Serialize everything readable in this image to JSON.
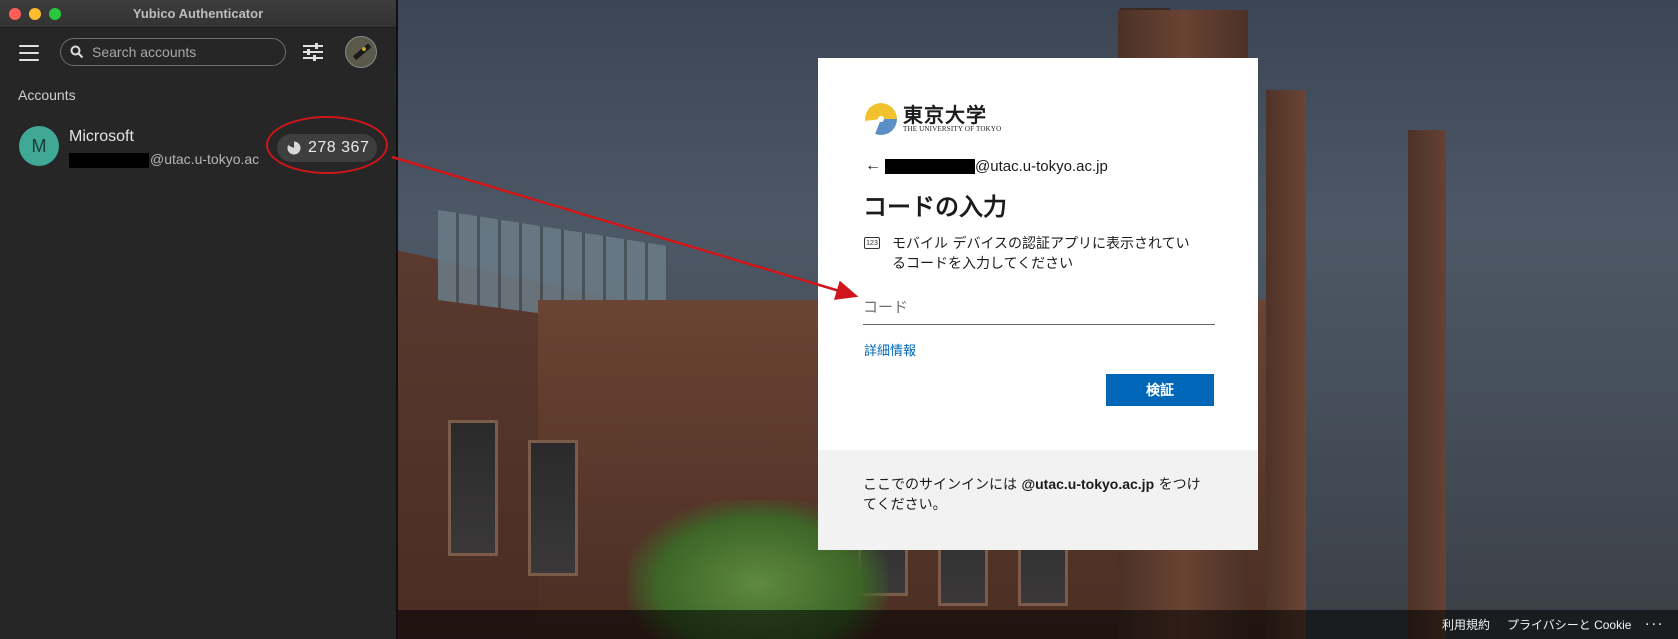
{
  "yubico": {
    "window_title": "Yubico Authenticator",
    "search_placeholder": "Search accounts",
    "section_label": "Accounts",
    "account": {
      "avatar_letter": "M",
      "name": "Microsoft",
      "email_suffix": "@utac.u-tokyo.ac",
      "code": "278 367"
    },
    "icons": [
      "menu-icon",
      "search-icon",
      "settings-sliders-icon",
      "yubikey-icon",
      "countdown-pie-icon"
    ]
  },
  "signin": {
    "logo_jp": "東京大学",
    "logo_en": "THE UNIVERSITY OF TOKYO",
    "back_email_suffix": "@utac.u-tokyo.ac.jp",
    "title": "コードの入力",
    "info_icon_text": "123",
    "info_text": "モバイル デバイスの認証アプリに表示されているコードを入力してください",
    "code_placeholder": "コード",
    "more_info_link": "詳細情報",
    "verify_button": "検証",
    "footer_prefix": "ここでのサインインには ",
    "footer_domain": "@utac.u-tokyo.ac.jp",
    "footer_suffix": " をつけてください。",
    "accent_color": "#0067b8"
  },
  "page_footer": {
    "terms": "利用規約",
    "privacy": "プライバシーと Cookie",
    "more": "..."
  },
  "annotation": {
    "color": "#d0161b"
  }
}
